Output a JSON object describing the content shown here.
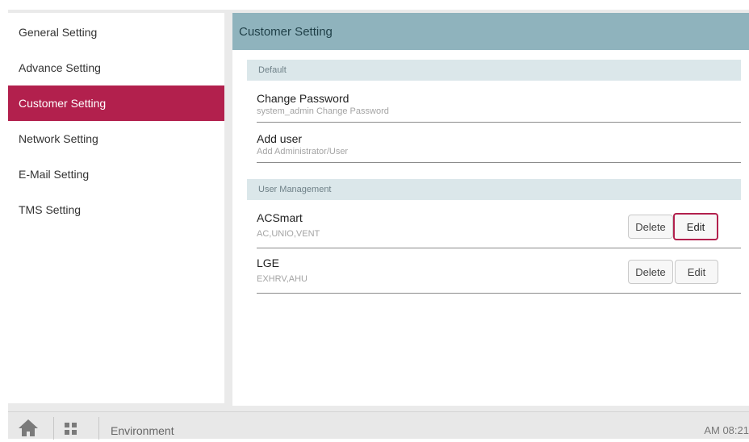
{
  "sidebar": {
    "items": [
      {
        "label": "General Setting",
        "active": false
      },
      {
        "label": "Advance Setting",
        "active": false
      },
      {
        "label": "Customer Setting",
        "active": true
      },
      {
        "label": "Network Setting",
        "active": false
      },
      {
        "label": "E-Mail Setting",
        "active": false
      },
      {
        "label": "TMS Setting",
        "active": false
      }
    ]
  },
  "main": {
    "title": "Customer Setting",
    "sections": {
      "default_label": "Default",
      "user_management_label": "User Management"
    },
    "default_rows": [
      {
        "title": "Change Password",
        "subtitle": "system_admin Change Password"
      },
      {
        "title": "Add user",
        "subtitle": "Add Administrator/User"
      }
    ],
    "users": [
      {
        "name": "ACSmart",
        "types": "AC,UNIO,VENT",
        "delete_label": "Delete",
        "edit_label": "Edit"
      },
      {
        "name": "LGE",
        "types": "EXHRV,AHU",
        "delete_label": "Delete",
        "edit_label": "Edit"
      }
    ]
  },
  "bottombar": {
    "environment_label": "Environment",
    "clock": "AM 08:21"
  },
  "colors": {
    "accent": "#b2204d",
    "header_bg": "#8fb3bd",
    "section_bg": "#dbe7ea"
  },
  "icons": [
    "home-icon",
    "grid-menu-icon"
  ]
}
